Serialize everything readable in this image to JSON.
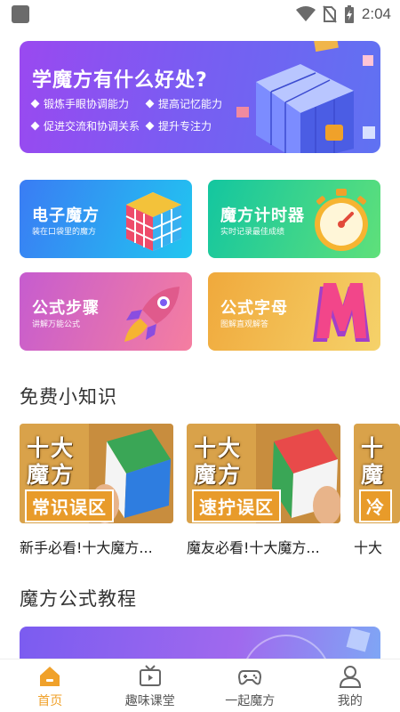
{
  "status_bar": {
    "time": "2:04"
  },
  "banner": {
    "title": "学魔方有什么好处?",
    "points": [
      "锻炼手眼协调能力",
      "提高记忆能力",
      "促进交流和协调关系",
      "提升专注力"
    ]
  },
  "features": [
    {
      "title": "电子魔方",
      "subtitle": "装在口袋里的魔方",
      "icon": "rubiks-cube-icon"
    },
    {
      "title": "魔方计时器",
      "subtitle": "实时记录最佳成绩",
      "icon": "stopwatch-icon"
    },
    {
      "title": "公式步骤",
      "subtitle": "讲解万能公式",
      "icon": "rocket-icon"
    },
    {
      "title": "公式字母",
      "subtitle": "图解直观解答",
      "icon": "letter-m-icon"
    }
  ],
  "knowledge": {
    "title": "免费小知识",
    "videos": [
      {
        "line1": "十大",
        "line2": "魔方",
        "strip": "常识误区",
        "caption": "新手必看!十大魔方..."
      },
      {
        "line1": "十大",
        "line2": "魔方",
        "strip": "速拧误区",
        "caption": "魔友必看!十大魔方..."
      },
      {
        "line1": "十",
        "line2": "魔",
        "strip": "冷",
        "caption": "十大"
      }
    ]
  },
  "tutorial": {
    "title": "魔方公式教程"
  },
  "nav": [
    {
      "label": "首页",
      "icon": "home-icon",
      "active": true
    },
    {
      "label": "趣味课堂",
      "icon": "tv-icon",
      "active": false
    },
    {
      "label": "一起魔方",
      "icon": "gamepad-icon",
      "active": false
    },
    {
      "label": "我的",
      "icon": "user-icon",
      "active": false
    }
  ],
  "colors": {
    "accent": "#f0a12a",
    "banner": "#8a52f0"
  }
}
